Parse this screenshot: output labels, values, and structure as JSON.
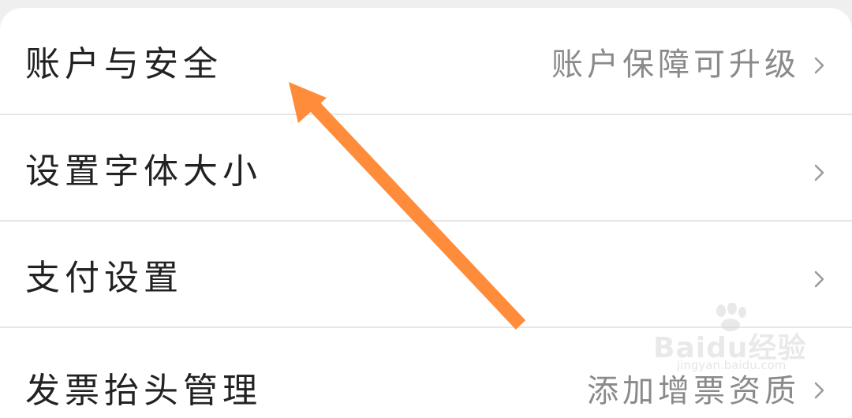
{
  "settings_list": {
    "items": [
      {
        "label": "账户与安全",
        "value": "账户保障可升级",
        "chevron": "chevron-right-icon"
      },
      {
        "label": "设置字体大小",
        "value": "",
        "chevron": "chevron-right-icon"
      },
      {
        "label": "支付设置",
        "value": "",
        "chevron": "chevron-right-icon"
      },
      {
        "label": "发票抬头管理",
        "value": "添加增票资质",
        "chevron": "chevron-right-icon"
      }
    ]
  },
  "annotation": {
    "arrow_color": "#ff8c3a",
    "arrow_icon": "arrow-pointer-icon"
  },
  "watermark": {
    "logo_text": "Baidu经验",
    "url_text": "jingyan.baidu.com"
  },
  "colors": {
    "background": "#efefef",
    "card": "#ffffff",
    "label_text": "#222222",
    "value_text": "#8a8a8a",
    "divider": "#e6e6e6"
  }
}
